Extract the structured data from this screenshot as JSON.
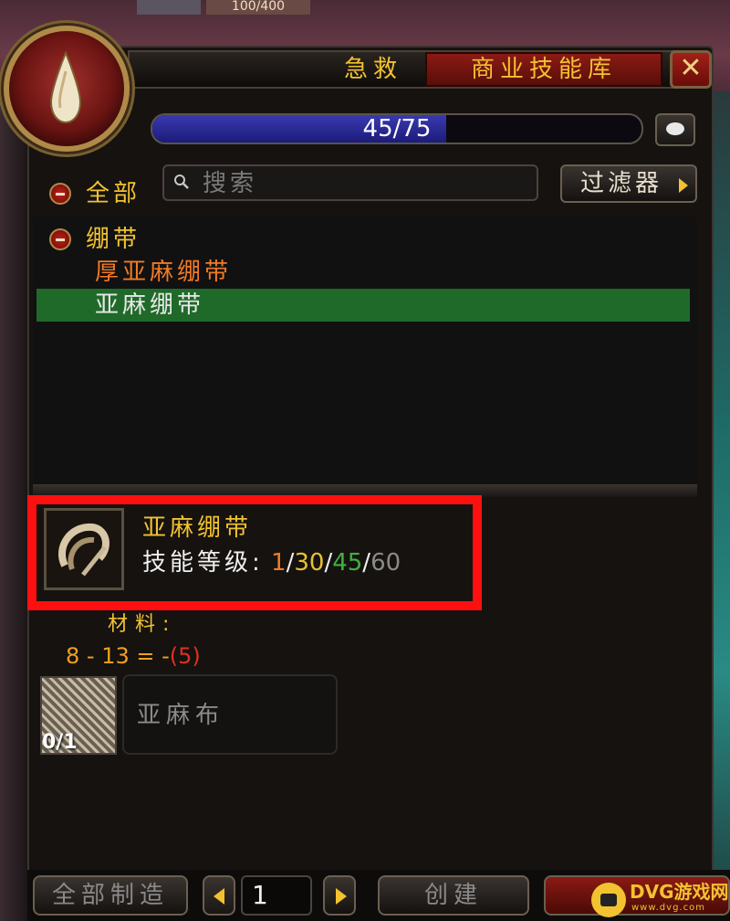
{
  "top_unit": {
    "hp_text": "100/400"
  },
  "window": {
    "tabs": [
      {
        "label": "急救"
      },
      {
        "label": "商业技能库"
      }
    ],
    "close_label": "✕"
  },
  "skill_progress": {
    "text": "45/75",
    "current": 45,
    "max": 75
  },
  "search": {
    "placeholder": "搜索"
  },
  "filter_button": "过滤器",
  "list": {
    "all_label": "全部",
    "category": "绷带",
    "recipes": [
      {
        "name": "厚亚麻绷带",
        "difficulty_color": "#f07a28"
      },
      {
        "name": "亚麻绷带",
        "selected": true
      }
    ]
  },
  "detail": {
    "name": "亚麻绷带",
    "skill_label": "技能等级:",
    "levels": [
      "1",
      "30",
      "45",
      "60"
    ],
    "level_colors": [
      "#f07a28",
      "#e8c030",
      "#40b040",
      "#8a8a8a"
    ]
  },
  "materials": {
    "title": "材料:",
    "formula_prefix": "8 - 13 = -",
    "formula_neg": "(5)",
    "items": [
      {
        "name": "亚麻布",
        "count": "0/1",
        "icon": "linen-cloth-icon"
      }
    ]
  },
  "bottom": {
    "create_all": "全部制造",
    "quantity": "1",
    "create": "创建"
  },
  "watermark": {
    "text": "DVG游戏网",
    "sub": "www.dvg.com"
  }
}
